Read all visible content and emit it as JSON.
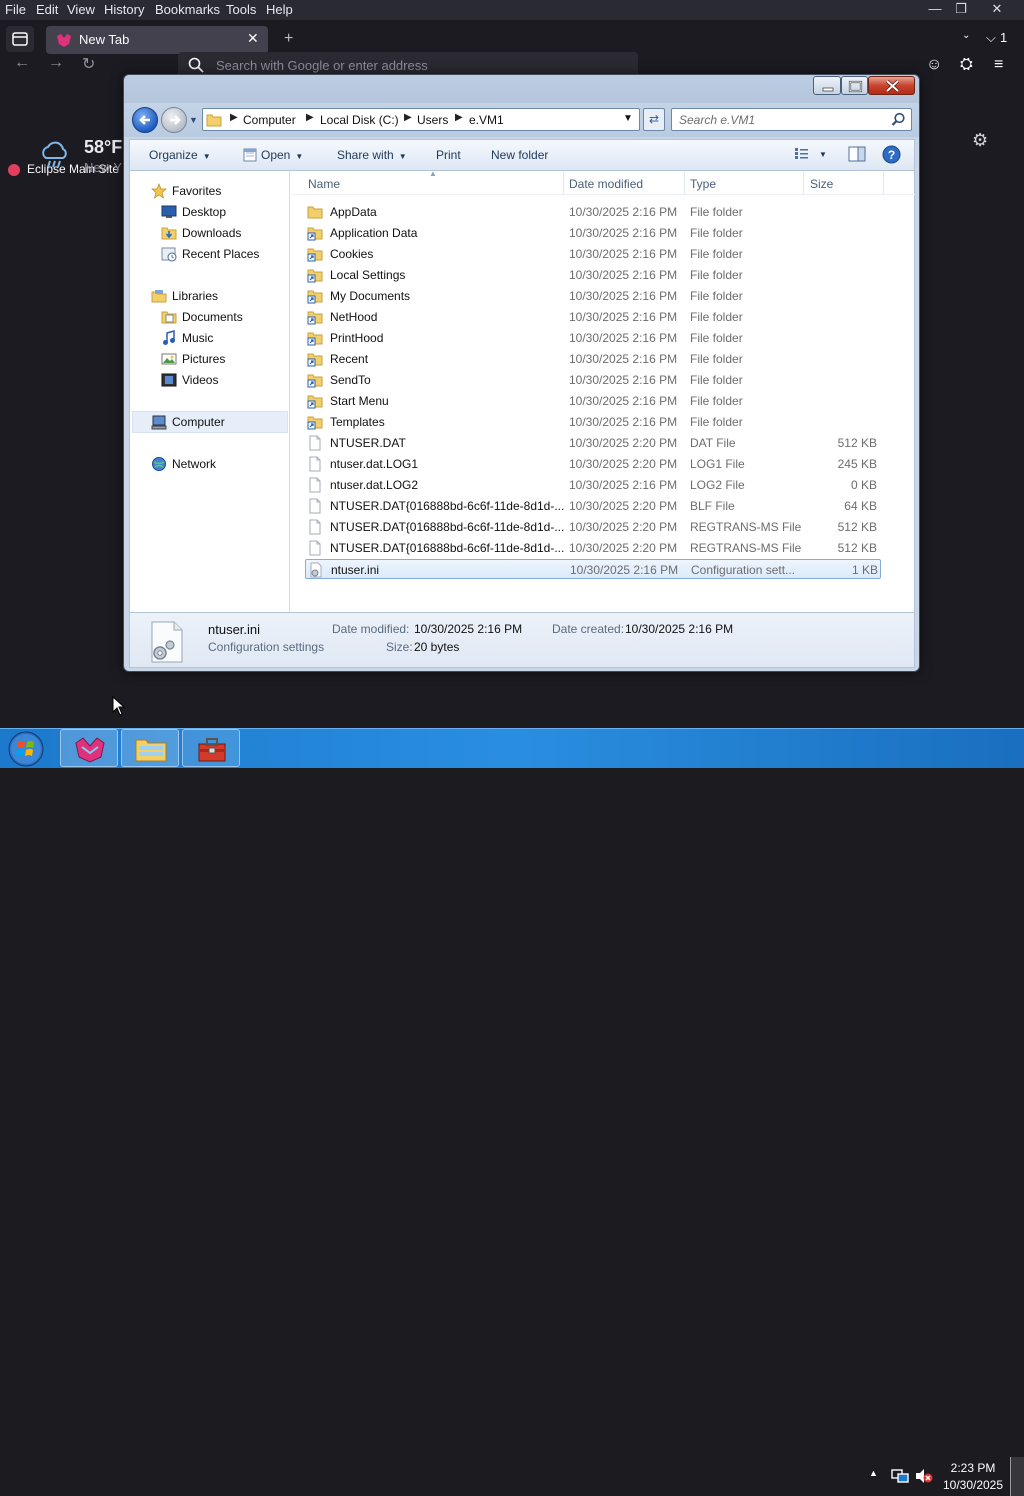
{
  "browser": {
    "menu": [
      "File",
      "Edit",
      "View",
      "History",
      "Bookmarks",
      "Tools",
      "Help"
    ],
    "tab_title": "New Tab",
    "url_placeholder": "Search with Google or enter address",
    "bookmark": "Eclipse Main Site",
    "all_tabs_count": "1",
    "weather": {
      "temp": "58°F",
      "location": "New Y"
    }
  },
  "explorer": {
    "breadcrumb": [
      "Computer",
      "Local Disk (C:)",
      "Users",
      "e.VM1"
    ],
    "search_placeholder": "Search e.VM1",
    "toolbar": {
      "organize": "Organize",
      "open": "Open",
      "share_with": "Share with",
      "print": "Print",
      "new_folder": "New folder"
    },
    "nav": {
      "favorites": "Favorites",
      "desktop": "Desktop",
      "downloads": "Downloads",
      "recent_places": "Recent Places",
      "libraries": "Libraries",
      "documents": "Documents",
      "music": "Music",
      "pictures": "Pictures",
      "videos": "Videos",
      "computer": "Computer",
      "network": "Network"
    },
    "columns": {
      "name": "Name",
      "date": "Date modified",
      "type": "Type",
      "size": "Size"
    },
    "files": [
      {
        "name": "AppData",
        "date": "10/30/2025 2:16 PM",
        "type": "File folder",
        "size": "",
        "icon": "folder-icon"
      },
      {
        "name": "Application Data",
        "date": "10/30/2025 2:16 PM",
        "type": "File folder",
        "size": "",
        "icon": "shortcut-folder-icon"
      },
      {
        "name": "Cookies",
        "date": "10/30/2025 2:16 PM",
        "type": "File folder",
        "size": "",
        "icon": "shortcut-folder-icon"
      },
      {
        "name": "Local Settings",
        "date": "10/30/2025 2:16 PM",
        "type": "File folder",
        "size": "",
        "icon": "shortcut-folder-icon"
      },
      {
        "name": "My Documents",
        "date": "10/30/2025 2:16 PM",
        "type": "File folder",
        "size": "",
        "icon": "shortcut-folder-icon"
      },
      {
        "name": "NetHood",
        "date": "10/30/2025 2:16 PM",
        "type": "File folder",
        "size": "",
        "icon": "shortcut-folder-icon"
      },
      {
        "name": "PrintHood",
        "date": "10/30/2025 2:16 PM",
        "type": "File folder",
        "size": "",
        "icon": "shortcut-folder-icon"
      },
      {
        "name": "Recent",
        "date": "10/30/2025 2:16 PM",
        "type": "File folder",
        "size": "",
        "icon": "shortcut-folder-icon"
      },
      {
        "name": "SendTo",
        "date": "10/30/2025 2:16 PM",
        "type": "File folder",
        "size": "",
        "icon": "shortcut-folder-icon"
      },
      {
        "name": "Start Menu",
        "date": "10/30/2025 2:16 PM",
        "type": "File folder",
        "size": "",
        "icon": "shortcut-folder-icon"
      },
      {
        "name": "Templates",
        "date": "10/30/2025 2:16 PM",
        "type": "File folder",
        "size": "",
        "icon": "shortcut-folder-icon"
      },
      {
        "name": "NTUSER.DAT",
        "date": "10/30/2025 2:20 PM",
        "type": "DAT File",
        "size": "512 KB",
        "icon": "file-icon"
      },
      {
        "name": "ntuser.dat.LOG1",
        "date": "10/30/2025 2:20 PM",
        "type": "LOG1 File",
        "size": "245 KB",
        "icon": "file-icon"
      },
      {
        "name": "ntuser.dat.LOG2",
        "date": "10/30/2025 2:16 PM",
        "type": "LOG2 File",
        "size": "0 KB",
        "icon": "file-icon"
      },
      {
        "name": "NTUSER.DAT{016888bd-6c6f-11de-8d1d-...",
        "date": "10/30/2025 2:20 PM",
        "type": "BLF File",
        "size": "64 KB",
        "icon": "file-icon"
      },
      {
        "name": "NTUSER.DAT{016888bd-6c6f-11de-8d1d-...",
        "date": "10/30/2025 2:20 PM",
        "type": "REGTRANS-MS File",
        "size": "512 KB",
        "icon": "file-icon"
      },
      {
        "name": "NTUSER.DAT{016888bd-6c6f-11de-8d1d-...",
        "date": "10/30/2025 2:20 PM",
        "type": "REGTRANS-MS File",
        "size": "512 KB",
        "icon": "file-icon"
      },
      {
        "name": "ntuser.ini",
        "date": "10/30/2025 2:16 PM",
        "type": "Configuration sett...",
        "size": "1 KB",
        "icon": "config-file-icon",
        "selected": true
      }
    ],
    "details": {
      "name": "ntuser.ini",
      "type": "Configuration settings",
      "modified_label": "Date modified:",
      "modified": "10/30/2025 2:16 PM",
      "created_label": "Date created:",
      "created": "10/30/2025 2:16 PM",
      "size_label": "Size:",
      "size": "20 bytes"
    }
  },
  "taskbar": {
    "time": "2:23 PM",
    "date": "10/30/2025"
  }
}
